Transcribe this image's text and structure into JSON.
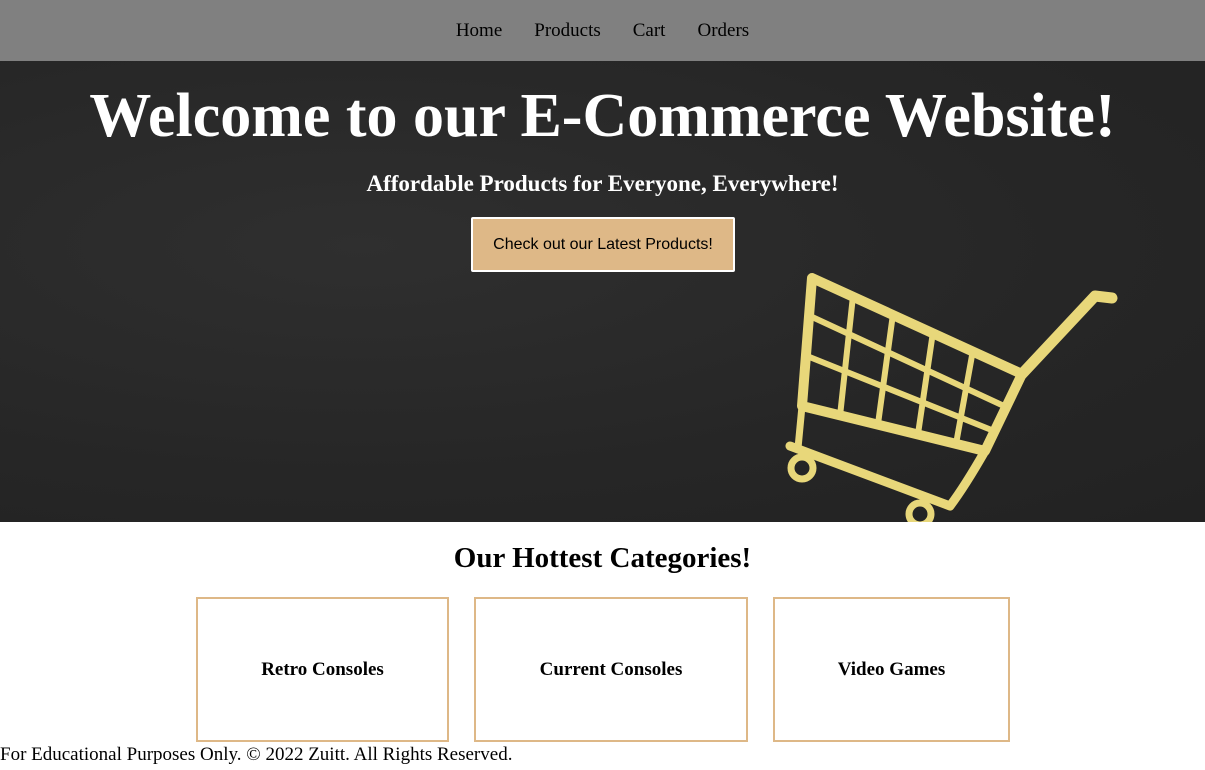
{
  "nav": {
    "links": [
      {
        "label": "Home"
      },
      {
        "label": "Products"
      },
      {
        "label": "Cart"
      },
      {
        "label": "Orders"
      }
    ]
  },
  "hero": {
    "title": "Welcome to our E-Commerce Website!",
    "subtitle": "Affordable Products for Everyone, Everywhere!",
    "cta_label": "Check out our Latest Products!",
    "image_icon": "shopping-cart-icon"
  },
  "categories": {
    "heading": "Our Hottest Categories!",
    "items": [
      {
        "label": "Retro Consoles"
      },
      {
        "label": "Current Consoles"
      },
      {
        "label": "Video Games"
      }
    ]
  },
  "footer": {
    "text": "For Educational Purposes Only. © 2022 Zuitt. All Rights Reserved."
  },
  "colors": {
    "navbar_bg": "#808080",
    "hero_bg": "#262626",
    "accent": "#deb887",
    "cart_gold": "#e8d77a"
  }
}
